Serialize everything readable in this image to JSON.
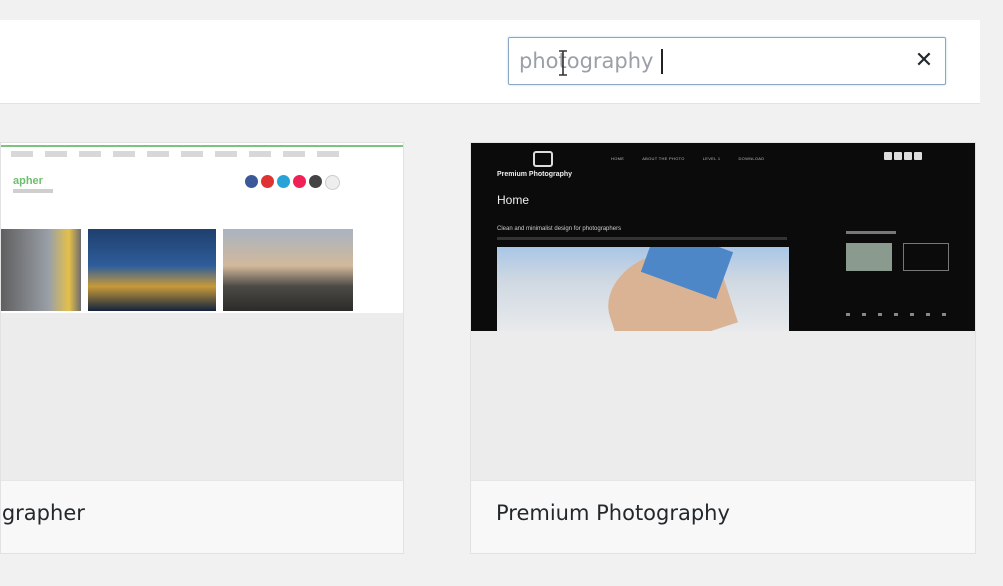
{
  "search": {
    "value": "photography",
    "clear_label": "✕"
  },
  "themes": [
    {
      "name": "ographer"
    },
    {
      "name": "Premium Photography"
    }
  ],
  "preview_right": {
    "brand": "Premium Photography",
    "nav": [
      "HOME",
      "ABOUT THE PHOTO",
      "LEVEL 1",
      "DOWNLOAD"
    ],
    "page_heading": "Home",
    "post_title": "Clean and minimalist design for photographers"
  },
  "preview_left": {
    "brand_fragment": "apher"
  },
  "colors": {
    "accent_green": "#7bc47f",
    "search_border": "#8fa7c0"
  },
  "icons": {
    "clear": "close-icon",
    "cursor": "text-cursor-icon"
  }
}
